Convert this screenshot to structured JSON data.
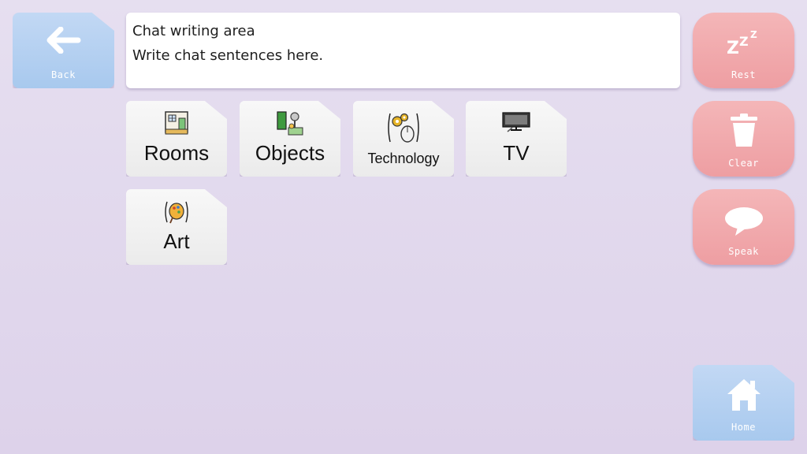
{
  "left_panel": {
    "back_label": "Back"
  },
  "chat": {
    "title": "Chat writing area",
    "placeholder": "Write chat sentences here."
  },
  "right_panel": {
    "rest_label": "Rest",
    "clear_label": "Clear",
    "speak_label": "Speak",
    "home_label": "Home"
  },
  "categories": [
    {
      "label": "Rooms",
      "icon": "rooms-icon"
    },
    {
      "label": "Objects",
      "icon": "objects-icon"
    },
    {
      "label": "Technology",
      "icon": "technology-icon"
    },
    {
      "label": "TV",
      "icon": "tv-icon"
    },
    {
      "label": "Art",
      "icon": "art-icon"
    }
  ],
  "colors": {
    "background": "#e2d8ee",
    "blue_button": "#b4d0f1",
    "red_button": "#f1a9ad",
    "tile": "#f2f2f2"
  }
}
